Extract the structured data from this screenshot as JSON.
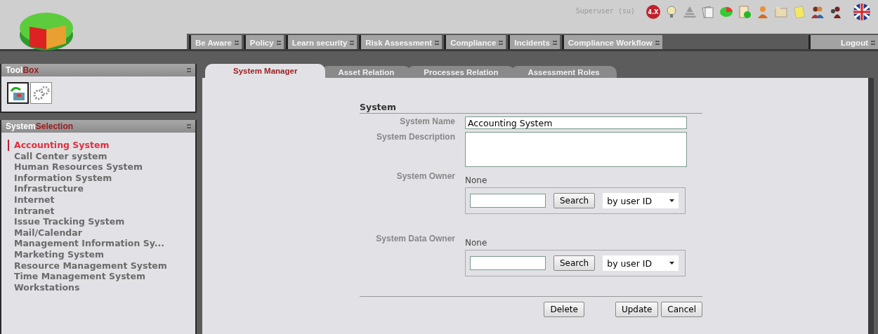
{
  "header": {
    "user": "Superuser (su)",
    "version_badge": "4.X"
  },
  "nav": [
    {
      "label": "Be Aware"
    },
    {
      "label": "Policy"
    },
    {
      "label": "Learn security"
    },
    {
      "label": "Risk Assessment"
    },
    {
      "label": "Compliance"
    },
    {
      "label": "Incidents"
    },
    {
      "label": "Compliance Workflow"
    }
  ],
  "logout": "Logout",
  "toolbox": {
    "title_plain": "Tool",
    "title_accent": "Box"
  },
  "system_selection": {
    "title_plain": "System",
    "title_accent": "Selection",
    "items": [
      {
        "label": "Accounting System",
        "selected": true
      },
      {
        "label": "Call Center system",
        "selected": false
      },
      {
        "label": "Human Resources System",
        "selected": false
      },
      {
        "label": "Information System",
        "selected": false
      },
      {
        "label": "Infrastructure",
        "selected": false
      },
      {
        "label": "Internet",
        "selected": false
      },
      {
        "label": "Intranet",
        "selected": false
      },
      {
        "label": "Issue Tracking System",
        "selected": false
      },
      {
        "label": "Mail/Calendar",
        "selected": false
      },
      {
        "label": "Management Information Sy...",
        "selected": false
      },
      {
        "label": "Marketing System",
        "selected": false
      },
      {
        "label": "Resource Management System",
        "selected": false
      },
      {
        "label": "Time Management System",
        "selected": false
      },
      {
        "label": "Workstations",
        "selected": false
      }
    ]
  },
  "tabs": [
    {
      "label": "System Manager",
      "selected": true
    },
    {
      "label": "Asset Relation",
      "selected": false
    },
    {
      "label": "Processes Relation",
      "selected": false
    },
    {
      "label": "Assessment Roles",
      "selected": false
    }
  ],
  "form": {
    "section": "System",
    "system_name": {
      "label": "System Name",
      "value": "Accounting System"
    },
    "system_description": {
      "label": "System Description"
    },
    "owners": [
      {
        "label": "System Owner",
        "current": "None",
        "search_button": "Search",
        "mode": "by user ID"
      },
      {
        "label": "System Data Owner",
        "current": "None",
        "search_button": "Search",
        "mode": "by user ID"
      }
    ],
    "buttons": {
      "delete": "Delete",
      "update": "Update",
      "cancel": "Cancel"
    }
  }
}
